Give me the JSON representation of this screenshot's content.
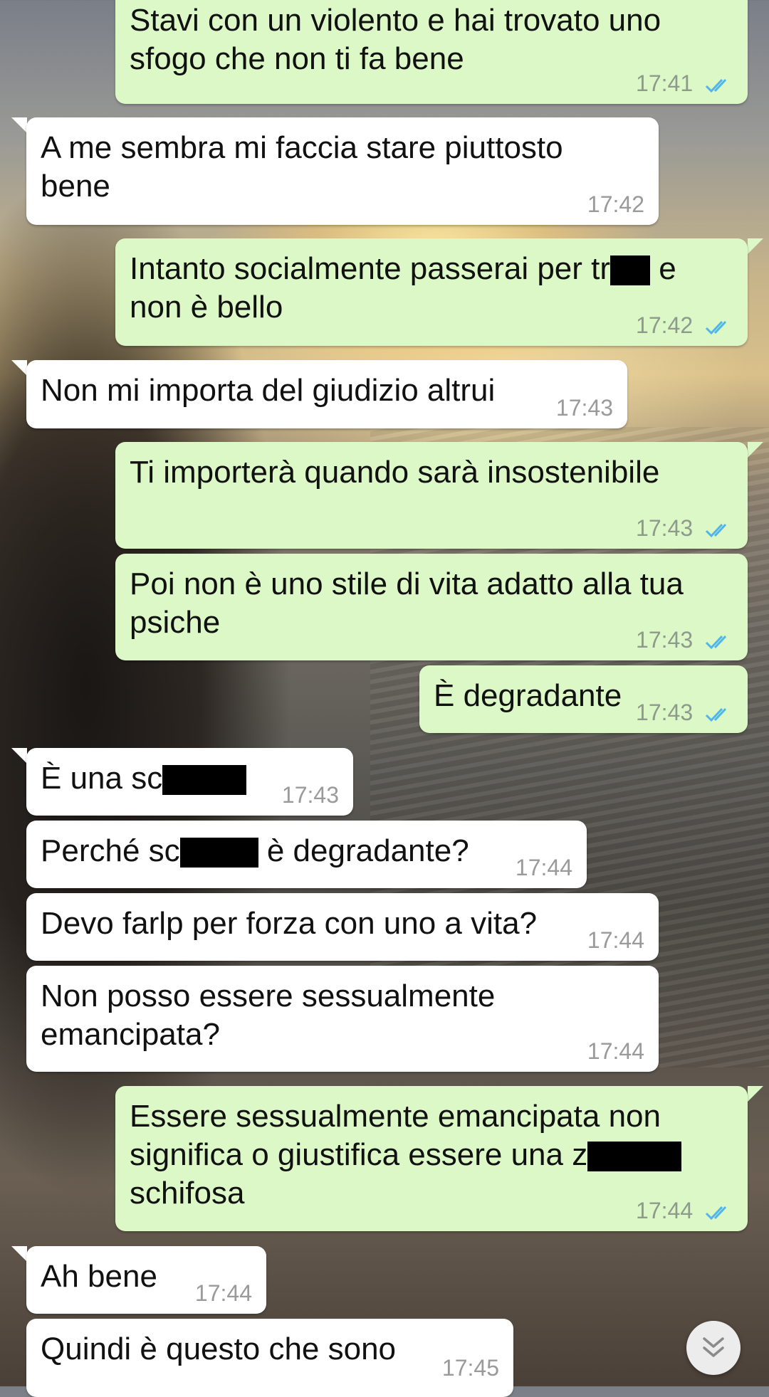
{
  "colors": {
    "outgoing_bubble": "#dcf8c6",
    "incoming_bubble": "#ffffff",
    "read_ticks": "#4fb6ec",
    "timestamp": "#8e9a8c"
  },
  "messages": [
    {
      "direction": "out",
      "text_lines": [
        "Stavi con un violento e hai trovato uno",
        "sfogo che non ti fa bene"
      ],
      "time": "17:41",
      "status": "read"
    },
    {
      "direction": "in",
      "text_lines": [
        "A me sembra mi faccia stare piuttosto",
        "bene"
      ],
      "time": "17:42"
    },
    {
      "direction": "out",
      "text_before": "Intanto socialmente passerai per tr",
      "text_after": " e",
      "text_line2": "non è bello",
      "time": "17:42",
      "status": "read"
    },
    {
      "direction": "in",
      "text": "Non mi importa del giudizio altrui",
      "time": "17:43"
    },
    {
      "direction": "out",
      "text": "Ti importerà quando sarà insostenibile",
      "time": "17:43",
      "status": "read"
    },
    {
      "direction": "out",
      "text_lines": [
        "Poi non è uno stile di vita adatto alla tua",
        "psiche"
      ],
      "time": "17:43",
      "status": "read"
    },
    {
      "direction": "out",
      "text": "È degradante",
      "time": "17:43",
      "status": "read"
    },
    {
      "direction": "in",
      "text_before": "È una sc",
      "time": "17:43"
    },
    {
      "direction": "in",
      "text_before": "Perché sc",
      "text_after": " è degradante?",
      "time": "17:44"
    },
    {
      "direction": "in",
      "text": "Devo farlp per forza con uno a vita?",
      "time": "17:44"
    },
    {
      "direction": "in",
      "text_lines": [
        "Non posso essere sessualmente",
        "emancipata?"
      ],
      "time": "17:44"
    },
    {
      "direction": "out",
      "text_line1": "Essere sessualmente emancipata non",
      "text_before": "significa o giustifica essere una z",
      "text_line3": "schifosa",
      "time": "17:44",
      "status": "read"
    },
    {
      "direction": "in",
      "text": "Ah bene",
      "time": "17:44"
    },
    {
      "direction": "in",
      "text": "Quindi è questo che sono",
      "time": "17:45"
    }
  ],
  "scroll_button": {
    "icon": "double-chevron-down-icon"
  }
}
